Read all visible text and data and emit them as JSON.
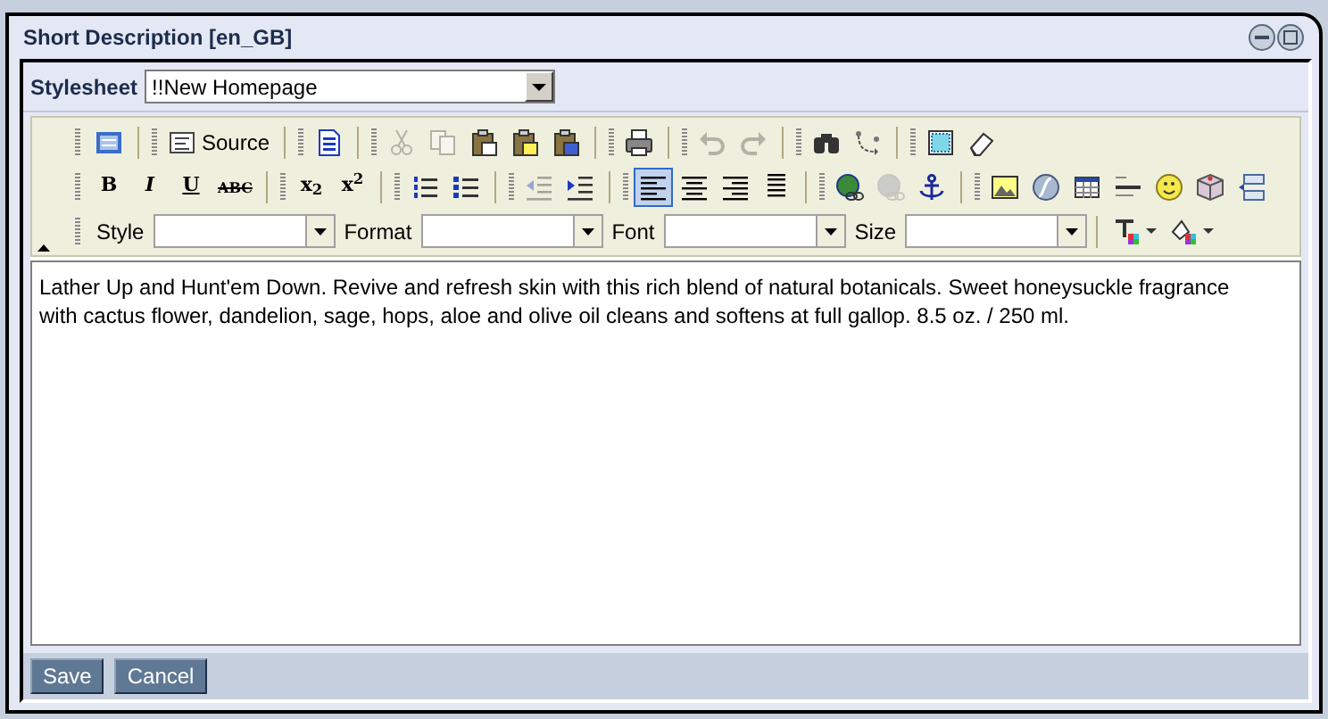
{
  "window": {
    "title": "Short Description [en_GB]"
  },
  "stylesheet": {
    "label": "Stylesheet",
    "value": "!!New Homepage"
  },
  "toolbar": {
    "lines": [
      {
        "items": [
          {
            "kind": "icon",
            "disabled": false,
            "selected": false
          },
          {
            "kind": "separator"
          },
          {
            "kind": "text",
            "label": "Source",
            "disabled": false,
            "selected": false
          },
          {
            "kind": "separator"
          },
          {
            "kind": "icon",
            "disabled": false,
            "selected": false
          },
          {
            "kind": "separator"
          },
          {
            "kind": "icon",
            "disabled": true,
            "selected": false
          },
          {
            "kind": "icon",
            "disabled": true,
            "selected": false
          },
          {
            "kind": "icon",
            "disabled": false,
            "selected": false
          },
          {
            "kind": "icon",
            "disabled": false,
            "selected": false
          },
          {
            "kind": "icon",
            "disabled": false,
            "selected": false
          },
          {
            "kind": "separator"
          },
          {
            "kind": "icon",
            "disabled": false,
            "selected": false
          },
          {
            "kind": "separator"
          },
          {
            "kind": "icon",
            "disabled": true,
            "selected": false
          },
          {
            "kind": "icon",
            "disabled": true,
            "selected": false
          },
          {
            "kind": "separator"
          },
          {
            "kind": "icon",
            "disabled": false,
            "selected": false
          },
          {
            "kind": "icon",
            "disabled": false,
            "selected": false
          },
          {
            "kind": "separator"
          },
          {
            "kind": "icon",
            "disabled": false,
            "selected": false
          },
          {
            "kind": "icon",
            "disabled": false,
            "selected": false
          }
        ]
      },
      {
        "items": [
          {
            "kind": "glyph",
            "label": "B",
            "disabled": false,
            "selected": false
          },
          {
            "kind": "glyph",
            "label": "I",
            "disabled": false,
            "selected": false
          },
          {
            "kind": "glyph",
            "label": "U",
            "disabled": false,
            "selected": false
          },
          {
            "kind": "glyph",
            "label": "ABC",
            "disabled": false,
            "selected": false
          },
          {
            "kind": "separator"
          },
          {
            "kind": "glyph",
            "label": "x$_{2}$",
            "disabled": false,
            "selected": false
          },
          {
            "kind": "glyph",
            "label": "x$^{2}$",
            "disabled": false,
            "selected": false
          },
          {
            "kind": "separator"
          },
          {
            "kind": "icon",
            "disabled": false,
            "selected": false
          },
          {
            "kind": "icon",
            "disabled": false,
            "selected": false
          },
          {
            "kind": "separator"
          },
          {
            "kind": "icon",
            "disabled": true,
            "selected": false
          },
          {
            "kind": "icon",
            "disabled": false,
            "selected": false
          },
          {
            "kind": "separator"
          },
          {
            "kind": "icon",
            "disabled": false,
            "selected": true
          },
          {
            "kind": "icon",
            "disabled": false,
            "selected": false
          },
          {
            "kind": "icon",
            "disabled": false,
            "selected": false
          },
          {
            "kind": "icon",
            "disabled": false,
            "selected": false
          },
          {
            "kind": "separator"
          },
          {
            "kind": "icon",
            "disabled": false,
            "selected": false
          },
          {
            "kind": "icon",
            "disabled": true,
            "selected": false
          },
          {
            "kind": "icon",
            "disabled": false,
            "selected": false
          },
          {
            "kind": "separator"
          },
          {
            "kind": "icon",
            "disabled": false,
            "selected": false
          },
          {
            "kind": "icon",
            "disabled": false,
            "selected": false
          },
          {
            "kind": "icon",
            "disabled": false,
            "selected": false
          },
          {
            "kind": "icon",
            "disabled": false,
            "selected": false
          },
          {
            "kind": "icon",
            "disabled": false,
            "selected": false
          },
          {
            "kind": "icon",
            "disabled": false,
            "selected": false
          },
          {
            "kind": "icon",
            "disabled": false,
            "selected": false
          }
        ]
      },
      {
        "items": [
          {
            "kind": "combo",
            "label": "Style"
          },
          {
            "kind": "combo",
            "label": "Format"
          },
          {
            "kind": "combo",
            "label": "Font"
          },
          {
            "kind": "combo",
            "label": "Size"
          },
          {
            "kind": "separator"
          },
          {
            "kind": "menu-icon",
            "disabled": false,
            "selected": false
          },
          {
            "kind": "menu-icon",
            "disabled": false,
            "selected": false
          }
        ]
      }
    ]
  },
  "content": "Lather Up and Hunt'em Down. Revive and refresh skin with this rich blend of natural botanicals. Sweet honeysuckle fragrance with cactus flower, dandelion, sage, hops, aloe and olive oil cleans and softens at full gallop. 8.5 oz. / 250 ml.",
  "buttons": [
    {
      "label": "Save"
    },
    {
      "label": "Cancel"
    }
  ]
}
